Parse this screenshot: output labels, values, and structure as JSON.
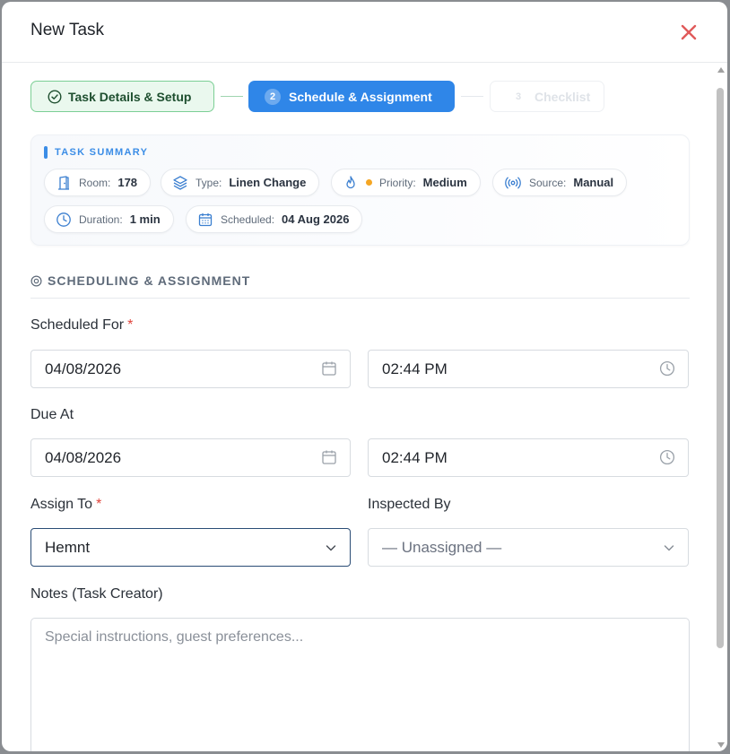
{
  "modal": {
    "title": "New Task",
    "close_icon": "close-x-icon",
    "close_color": "#e05a5a"
  },
  "stepper": {
    "steps": [
      {
        "number": "",
        "label": "Task Details & Setup",
        "state": "completed",
        "icon": "check-circle-icon"
      },
      {
        "number": "2",
        "label": "Schedule & Assignment",
        "state": "active"
      },
      {
        "number": "3",
        "label": "Checklist",
        "state": "pending"
      }
    ],
    "active_color": "#2f86e8",
    "completed_color": "#7ccf95"
  },
  "summary": {
    "title": "TASK SUMMARY",
    "chips": [
      {
        "icon": "door-icon",
        "label": "Room:",
        "value": "178"
      },
      {
        "icon": "layers-icon",
        "label": "Type:",
        "value": "Linen Change"
      },
      {
        "icon": "flame-icon",
        "label": "Priority:",
        "value": "Medium",
        "dot_color": "#f5a623"
      },
      {
        "icon": "broadcast-icon",
        "label": "Source:",
        "value": "Manual"
      },
      {
        "icon": "clock-icon",
        "label": "Duration:",
        "value": "1 min"
      },
      {
        "icon": "calendar-icon",
        "label": "Scheduled:",
        "value": "04 Aug 2026"
      }
    ]
  },
  "section": {
    "title": "SCHEDULING & ASSIGNMENT",
    "icon": "target-icon"
  },
  "form": {
    "scheduled_for": {
      "label": "Scheduled For",
      "required_mark": "*",
      "date": "04/08/2026",
      "time": "02:44 PM"
    },
    "due_at": {
      "label": "Due At",
      "date": "04/08/2026",
      "time": "02:44 PM"
    },
    "assign_to": {
      "label": "Assign To",
      "required_mark": "*",
      "value": "Hemnt"
    },
    "inspected_by": {
      "label": "Inspected By",
      "value": "— Unassigned —"
    },
    "notes": {
      "label": "Notes (Task Creator)",
      "placeholder": "Special instructions, guest preferences..."
    }
  }
}
